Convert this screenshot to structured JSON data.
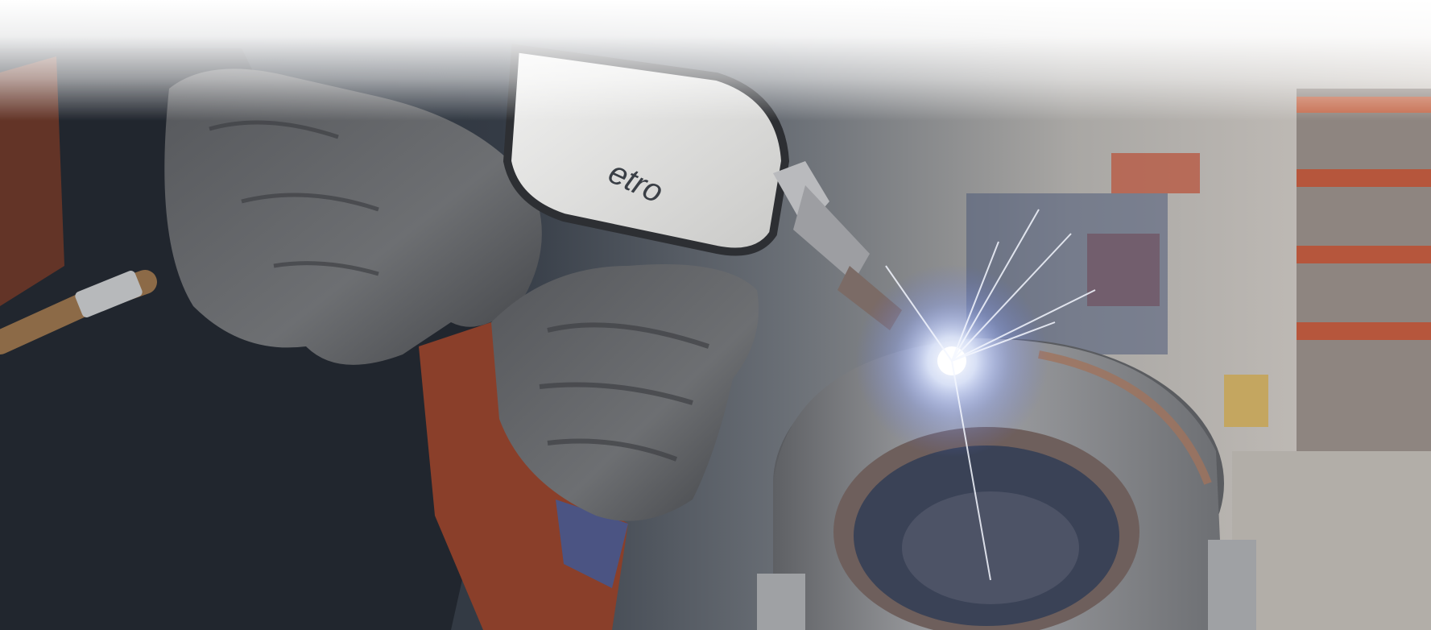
{
  "hero": {
    "brand_mark": "etro",
    "colors": {
      "background_dark": "#262d36",
      "glove": "#5b5d60",
      "metal": "#8d8f93",
      "spark": "#e8f0ff",
      "shelf_accent": "#b6563c"
    },
    "icons": {
      "welding_torch": "welding-torch-icon",
      "spark": "spark-icon"
    }
  }
}
